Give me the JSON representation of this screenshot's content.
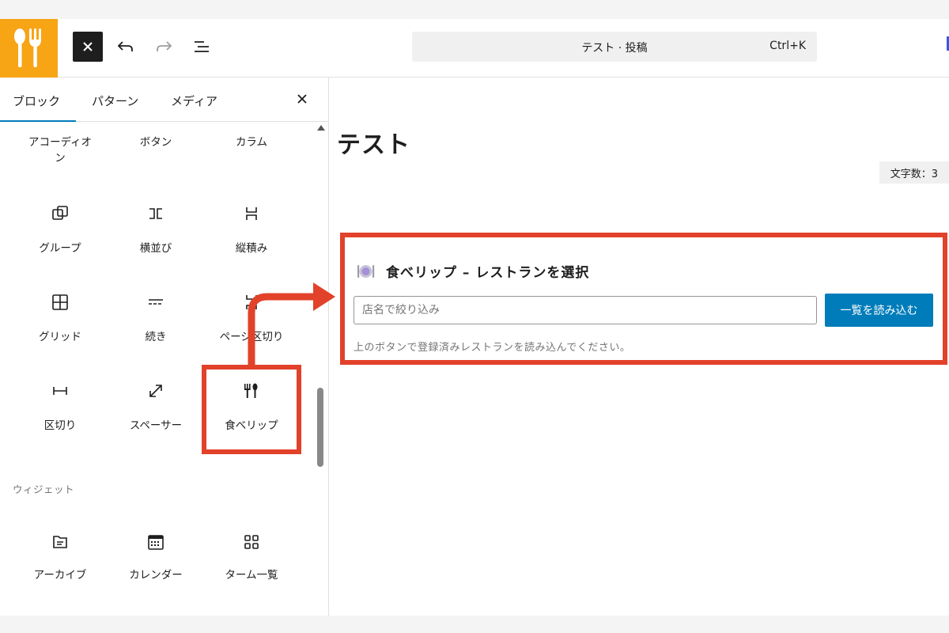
{
  "topbar": {
    "logo_icon": "fork-knife-icon",
    "brand_color": "#f7a415",
    "close_icon": "close-icon",
    "undo_icon": "undo-icon",
    "redo_icon": "redo-icon",
    "outline_icon": "document-overview-icon",
    "command_title": "テスト · 投稿",
    "command_shortcut": "Ctrl+K"
  },
  "inserter": {
    "tabs": [
      {
        "label": "ブロック",
        "active": true
      },
      {
        "label": "パターン",
        "active": false
      },
      {
        "label": "メディア",
        "active": false
      }
    ],
    "close_icon": "close-icon",
    "blocks": [
      {
        "label": "アコーディオン",
        "icon": null
      },
      {
        "label": "ボタン",
        "icon": null
      },
      {
        "label": "カラム",
        "icon": null
      },
      {
        "label": "グループ",
        "icon": "group-icon"
      },
      {
        "label": "横並び",
        "icon": "row-icon"
      },
      {
        "label": "縦積み",
        "icon": "stack-icon"
      },
      {
        "label": "グリッド",
        "icon": "grid-icon"
      },
      {
        "label": "続き",
        "icon": "more-icon"
      },
      {
        "label": "ページ区切り",
        "icon": "page-break-icon"
      },
      {
        "label": "区切り",
        "icon": "separator-icon"
      },
      {
        "label": "スペーサー",
        "icon": "spacer-icon"
      },
      {
        "label": "食べリップ",
        "icon": "fork-knife-icon"
      }
    ],
    "widgets_heading": "ウィジェット",
    "widgets": [
      {
        "label": "アーカイブ",
        "icon": "archive-icon"
      },
      {
        "label": "カレンダー",
        "icon": "calendar-icon"
      },
      {
        "label": "ターム一覧",
        "icon": "category-grid-icon"
      }
    ]
  },
  "editor": {
    "post_title": "テスト",
    "word_count": "文字数：3",
    "plugin_block": {
      "icon": "plate-icon",
      "title": "食べリップ – レストランを選択",
      "filter_placeholder": "店名で絞り込み",
      "filter_value": "",
      "load_button": "一覧を読み込む",
      "hint": "上のボタンで登録済みレストランを読み込んでください。"
    }
  },
  "annotation": {
    "color": "#e2412a"
  }
}
